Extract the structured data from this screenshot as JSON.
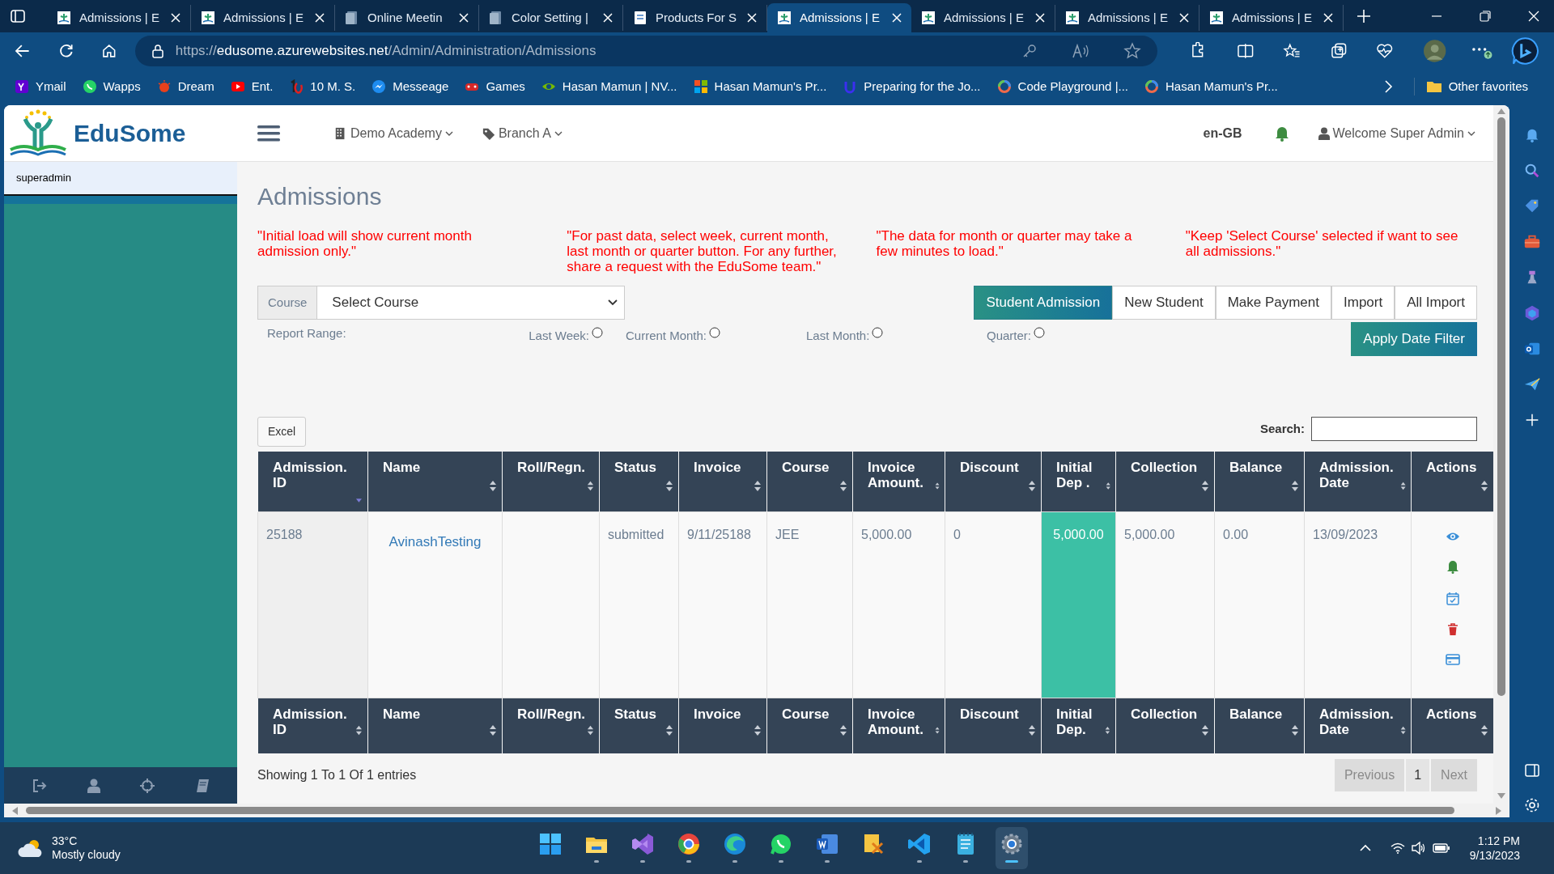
{
  "browser": {
    "tabs": [
      {
        "title": "Admissions | E",
        "kind": "app",
        "selected": false
      },
      {
        "title": "Admissions | E",
        "kind": "app",
        "selected": false
      },
      {
        "title": "Online Meetin",
        "kind": "document",
        "selected": false
      },
      {
        "title": "Color Setting |",
        "kind": "document",
        "selected": false
      },
      {
        "title": "Products For S",
        "kind": "page",
        "selected": false
      },
      {
        "title": "Admissions | E",
        "kind": "app",
        "selected": true
      },
      {
        "title": "Admissions | E",
        "kind": "app",
        "selected": false
      },
      {
        "title": "Admissions | E",
        "kind": "app",
        "selected": false
      },
      {
        "title": "Admissions | E",
        "kind": "app",
        "selected": false
      }
    ],
    "address": {
      "scheme": "https://",
      "host": "edusome.azurewebsites.net",
      "path": "/Admin/Administration/Admissions"
    },
    "bookmarks": [
      {
        "label": "Ymail",
        "kind": "yahoo"
      },
      {
        "label": "Wapps",
        "kind": "chat"
      },
      {
        "label": "Dream",
        "kind": "dream"
      },
      {
        "label": "Ent.",
        "kind": "video"
      },
      {
        "label": "10 M. S.",
        "kind": "ten"
      },
      {
        "label": "Messeage",
        "kind": "messenger"
      },
      {
        "label": "Games",
        "kind": "games"
      },
      {
        "label": "Hasan Mamun | NV...",
        "kind": "nvidia"
      },
      {
        "label": "Hasan Mamun's Pr...",
        "kind": "windows"
      },
      {
        "label": "Preparing for the Jo...",
        "kind": "udemy"
      },
      {
        "label": "Code Playground |...",
        "kind": "ring"
      },
      {
        "label": "Hasan Mamun's Pr...",
        "kind": "ring"
      }
    ],
    "other_favorites": "Other favorites"
  },
  "app": {
    "brand": "EduSome",
    "menus": [
      {
        "label": "Demo Academy",
        "kind": "building"
      },
      {
        "label": "Branch A",
        "kind": "tag"
      }
    ],
    "language": "en-GB",
    "user": "Welcome Super Admin",
    "sidebar_user": "superadmin"
  },
  "page": {
    "title": "Admissions",
    "notes": [
      "\"Initial load will show current month admission only.\"",
      "\"For past data, select week, current month, last month or quarter button. For any further, share a request with the EduSome team.\"",
      "\"The data for month or quarter may take a few minutes to load.\"",
      "\"Keep 'Select Course' selected if want to see all admissions.\""
    ],
    "course": {
      "label": "Course",
      "value": "Select Course"
    },
    "actions": [
      {
        "label": "Student Admission",
        "selected": true
      },
      {
        "label": "New Student",
        "selected": false
      },
      {
        "label": "Make Payment",
        "selected": false
      },
      {
        "label": "Import",
        "selected": false
      },
      {
        "label": "All Import",
        "selected": false
      }
    ],
    "report_range": {
      "label": "Report Range:",
      "options": [
        {
          "label": "Last Week:",
          "checked": false
        },
        {
          "label": "Current Month:",
          "checked": false
        },
        {
          "label": "Last Month:",
          "checked": false
        },
        {
          "label": "Quarter:",
          "checked": false
        }
      ]
    },
    "apply_button": "Apply Date Filter",
    "excel_button": "Excel",
    "search_label": "Search:",
    "table": {
      "columns": [
        {
          "label": "Admission. ID",
          "sorted": true
        },
        {
          "label": "Name",
          "sorted": false
        },
        {
          "label": "Roll/Regn.",
          "sorted": false
        },
        {
          "label": "Status",
          "sorted": false
        },
        {
          "label": "Invoice",
          "sorted": false
        },
        {
          "label": "Course",
          "sorted": false
        },
        {
          "label": "Invoice Amount.",
          "sorted": false
        },
        {
          "label": "Discount",
          "sorted": false
        },
        {
          "label": "Initial Dep .",
          "sorted": false
        },
        {
          "label": "Collection",
          "sorted": false
        },
        {
          "label": "Balance",
          "sorted": false
        },
        {
          "label": "Admission. Date",
          "sorted": false
        },
        {
          "label": "Actions",
          "sorted": false
        }
      ],
      "rows": [
        {
          "cells": [
            {
              "text": "25188",
              "kind": "id"
            },
            {
              "text": "AvinashTesting",
              "kind": "link"
            },
            {
              "text": "",
              "kind": "text"
            },
            {
              "text": "submitted",
              "kind": "text"
            },
            {
              "text": "9/11/25188",
              "kind": "text"
            },
            {
              "text": "JEE",
              "kind": "text"
            },
            {
              "text": "5,000.00",
              "kind": "text"
            },
            {
              "text": "0",
              "kind": "text"
            },
            {
              "text": "5,000.00",
              "kind": "highlight"
            },
            {
              "text": "5,000.00",
              "kind": "text"
            },
            {
              "text": "0.00",
              "kind": "text"
            },
            {
              "text": "13/09/2023",
              "kind": "text"
            },
            {
              "kind": "actions"
            }
          ]
        }
      ],
      "footer_columns": [
        "Admission. ID",
        "Name",
        "Roll/Regn.",
        "Status",
        "Invoice",
        "Course",
        "Invoice Amount.",
        "Discount",
        "Initial Dep.",
        "Collection",
        "Balance",
        "Admission. Date",
        "Actions"
      ]
    },
    "info": "Showing 1 To 1 Of 1 entries",
    "pagination": [
      {
        "label": "Previous",
        "disabled": true
      },
      {
        "label": "1",
        "disabled": false
      },
      {
        "label": "Next",
        "disabled": true
      }
    ]
  },
  "taskbar": {
    "temperature": "33°C",
    "weather": "Mostly cloudy",
    "time": "1:12 PM",
    "date": "9/13/2023"
  }
}
